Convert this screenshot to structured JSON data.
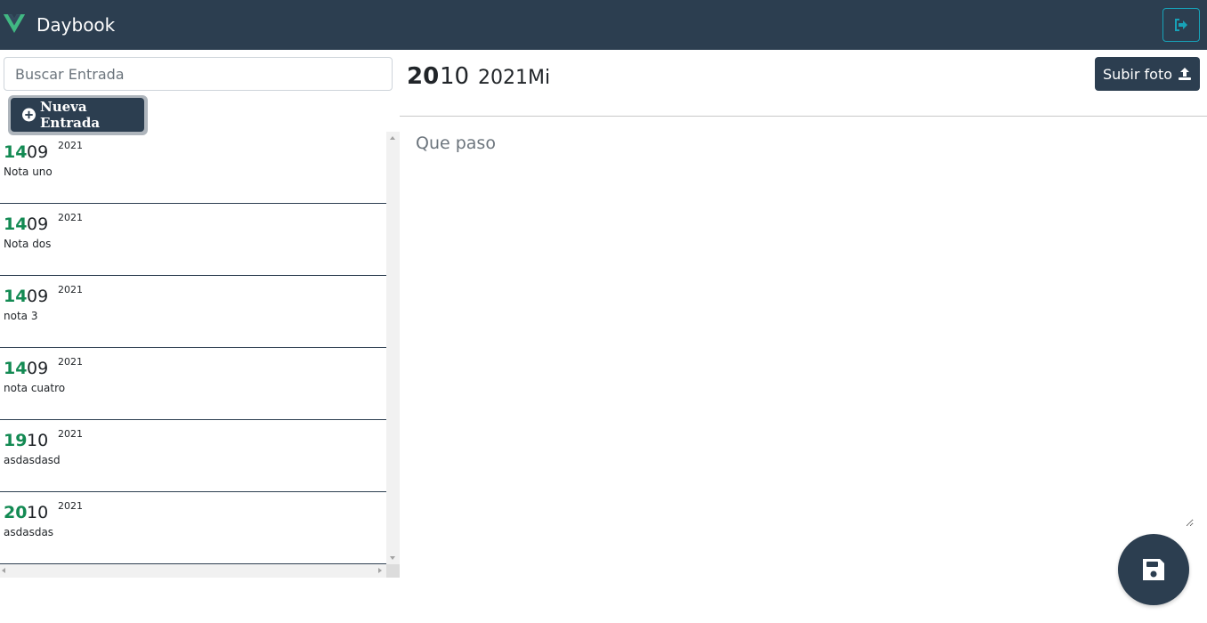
{
  "navbar": {
    "brand": "Daybook",
    "logo_icon": "vue-logo-icon",
    "logout_icon": "sign-out-icon",
    "colors": {
      "background": "#2c3e50",
      "logo_green": "#41b883",
      "logo_dark": "#34495e",
      "logout_border": "#17a2b8"
    }
  },
  "sidebar": {
    "search_placeholder": "Buscar Entrada",
    "search_value": "",
    "new_entry_label": "Nueva Entrada",
    "new_entry_icon": "plus-circle-icon",
    "entries": [
      {
        "day": "14",
        "month": "09",
        "year": "2021",
        "text": "Nota uno"
      },
      {
        "day": "14",
        "month": "09",
        "year": "2021",
        "text": "Nota dos"
      },
      {
        "day": "14",
        "month": "09",
        "year": "2021",
        "text": "nota 3"
      },
      {
        "day": "14",
        "month": "09",
        "year": "2021",
        "text": "nota cuatro"
      },
      {
        "day": "19",
        "month": "10",
        "year": "2021",
        "text": "asdasdasd"
      },
      {
        "day": "20",
        "month": "10",
        "year": "2021",
        "text": "asdasdas"
      }
    ],
    "colors": {
      "day": "#138a53",
      "divider": "#2c3e50"
    }
  },
  "main": {
    "day": "20",
    "month": "10",
    "year_weekday": "2021Mi",
    "upload_label": "Subir foto",
    "upload_icon": "upload-icon",
    "textarea_placeholder": "Que paso",
    "textarea_value": "",
    "save_icon": "save-icon"
  }
}
